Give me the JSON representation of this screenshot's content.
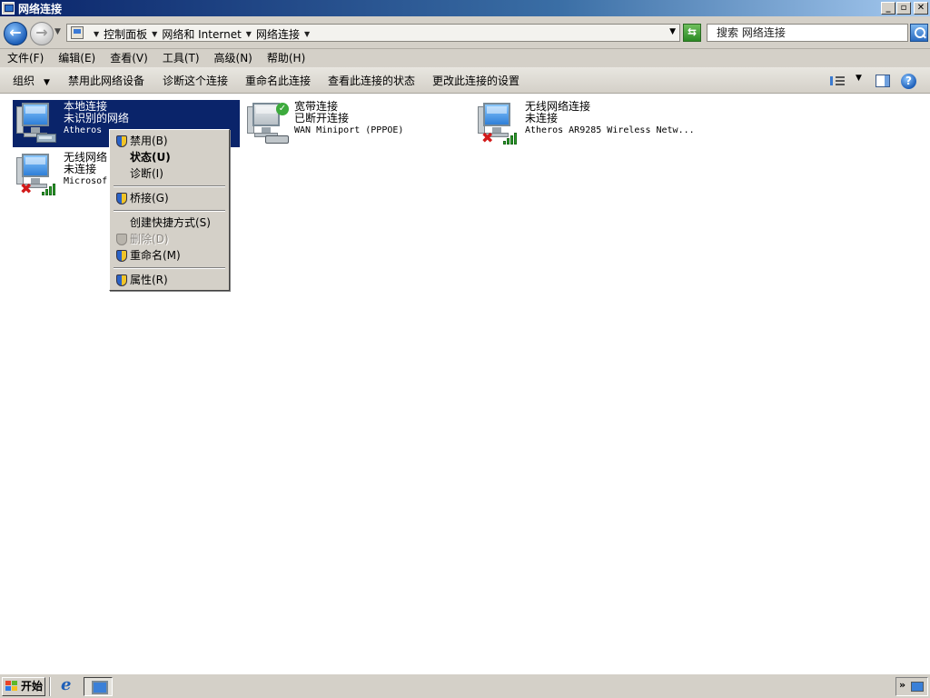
{
  "window": {
    "title": "网络连接",
    "buttons": {
      "minimize": "_",
      "maximize": "▫",
      "close": "✕"
    }
  },
  "address_bar": {
    "breadcrumbs": [
      "控制面板",
      "网络和 Internet",
      "网络连接"
    ],
    "search_placeholder": "搜索 网络连接"
  },
  "menu_bar": [
    "文件(F)",
    "编辑(E)",
    "查看(V)",
    "工具(T)",
    "高级(N)",
    "帮助(H)"
  ],
  "command_bar": {
    "organize": "组织",
    "disable_device": "禁用此网络设备",
    "diagnose": "诊断这个连接",
    "rename": "重命名此连接",
    "view_status": "查看此连接的状态",
    "change_settings": "更改此连接的设置"
  },
  "connections": [
    {
      "name": "本地连接",
      "status": "未识别的网络",
      "device": "Atheros ..."
    },
    {
      "name": "宽带连接",
      "status": "已断开连接",
      "device": "WAN Miniport (PPPOE)"
    },
    {
      "name": "无线网络连接",
      "status": "未连接",
      "device": "Atheros AR9285 Wireless Netw..."
    },
    {
      "name": "无线网络",
      "status": "未连接",
      "device": "Microsof"
    }
  ],
  "context_menu": [
    {
      "label": "禁用(B)",
      "shield": true
    },
    {
      "label": "状态(U)",
      "bold": true
    },
    {
      "label": "诊断(I)"
    },
    {
      "label": "桥接(G)",
      "shield": true
    },
    {
      "label": "创建快捷方式(S)"
    },
    {
      "label": "删除(D)",
      "shield": true,
      "disabled": true
    },
    {
      "label": "重命名(M)",
      "shield": true
    },
    {
      "label": "属性(R)",
      "shield": true
    }
  ],
  "taskbar": {
    "start_label": "开始"
  },
  "colors": {
    "selection": "#0a246a",
    "chrome": "#d4d0c8",
    "error": "#d21a1a",
    "ok": "#3caa3c"
  }
}
